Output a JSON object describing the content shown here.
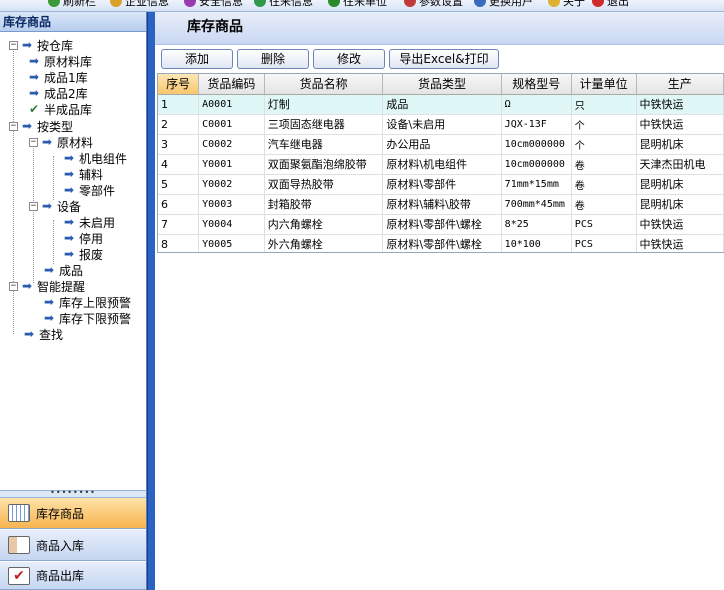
{
  "toolbar": {
    "items": [
      {
        "label": "刷新栏",
        "icon": "refresh-icon"
      },
      {
        "label": "企业信息",
        "icon": "company-icon"
      },
      {
        "label": "安全信息",
        "icon": "security-icon"
      },
      {
        "label": "往来信息",
        "icon": "contacts-icon"
      },
      {
        "label": "往来单位",
        "icon": "units-icon"
      },
      {
        "label": "参数设置",
        "icon": "settings-icon"
      },
      {
        "label": "更换用户",
        "icon": "switch-user-icon"
      },
      {
        "label": "关于",
        "icon": "about-icon"
      },
      {
        "label": "退出",
        "icon": "exit-icon"
      }
    ]
  },
  "sidebar": {
    "title": "库存商品",
    "tree": [
      {
        "label": "按仓库",
        "level": 0,
        "type": "expand"
      },
      {
        "label": "原材料库",
        "level": 1,
        "type": "arrow"
      },
      {
        "label": "成品1库",
        "level": 1,
        "type": "arrow"
      },
      {
        "label": "成品2库",
        "level": 1,
        "type": "arrow"
      },
      {
        "label": "半成品库",
        "level": 1,
        "type": "check"
      },
      {
        "label": "按类型",
        "level": 0,
        "type": "expand"
      },
      {
        "label": "原材料",
        "level": 1,
        "type": "expand"
      },
      {
        "label": "机电组件",
        "level": 2,
        "type": "arrow"
      },
      {
        "label": "辅料",
        "level": 2,
        "type": "arrow"
      },
      {
        "label": "零部件",
        "level": 2,
        "type": "arrow"
      },
      {
        "label": "设备",
        "level": 1,
        "type": "expand"
      },
      {
        "label": "未启用",
        "level": 2,
        "type": "arrow"
      },
      {
        "label": "停用",
        "level": 2,
        "type": "arrow"
      },
      {
        "label": "报废",
        "level": 2,
        "type": "arrow"
      },
      {
        "label": "成品",
        "level": 1,
        "type": "arrow"
      },
      {
        "label": "智能提醒",
        "level": 0,
        "type": "expand"
      },
      {
        "label": "库存上限预警",
        "level": 1,
        "type": "arrow"
      },
      {
        "label": "库存下限预警",
        "level": 1,
        "type": "arrow"
      },
      {
        "label": "查找",
        "level": 0,
        "type": "arrow"
      }
    ],
    "splitter": "••••••••",
    "nav": [
      {
        "label": "库存商品",
        "active": true,
        "icon": "calendar-grid-icon"
      },
      {
        "label": "商品入库",
        "active": false,
        "icon": "id-card-icon"
      },
      {
        "label": "商品出库",
        "active": false,
        "icon": "checklist-icon"
      }
    ]
  },
  "main": {
    "title": "库存商品",
    "buttons": [
      "添加",
      "删除",
      "修改",
      "导出Excel&打印"
    ],
    "table": {
      "columns": [
        "序号",
        "货品编码",
        "货品名称",
        "货品类型",
        "规格型号",
        "计量单位",
        "生产"
      ],
      "rows": [
        [
          "1",
          "A0001",
          "灯制",
          "成品",
          "Ω",
          "只",
          "中铁快运"
        ],
        [
          "2",
          "C0001",
          "三项固态继电器",
          "设备\\未启用",
          "JQX-13F",
          "个",
          "中铁快运"
        ],
        [
          "3",
          "C0002",
          "汽车继电器",
          "办公用品",
          "10cm000000",
          "个",
          "昆明机床"
        ],
        [
          "4",
          "Y0001",
          "双面聚氨酯泡绵胶带",
          "原材料\\机电组件",
          "10cm000000",
          "卷",
          "天津杰田机电"
        ],
        [
          "5",
          "Y0002",
          "双面导热胶带",
          "原材料\\零部件",
          "71mm*15mm",
          "卷",
          "昆明机床"
        ],
        [
          "6",
          "Y0003",
          "封箱胶带",
          "原材料\\辅料\\胶带",
          "700mm*45mm",
          "卷",
          "昆明机床"
        ],
        [
          "7",
          "Y0004",
          "内六角螺栓",
          "原材料\\零部件\\螺栓",
          "8*25",
          "PCS",
          "中铁快运"
        ],
        [
          "8",
          "Y0005",
          "外六角螺栓",
          "原材料\\零部件\\螺栓",
          "10*100",
          "PCS",
          "中铁快运"
        ]
      ],
      "selected_row": 0
    }
  }
}
